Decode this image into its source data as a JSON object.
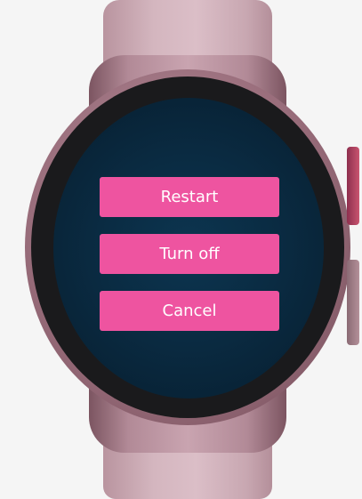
{
  "dialog": {
    "buttons": [
      {
        "label": "Restart"
      },
      {
        "label": "Turn off"
      },
      {
        "label": "Cancel"
      }
    ]
  },
  "colors": {
    "button_bg": "#ee54a0",
    "button_text": "#ffffff",
    "screen_bg": "#0a2b42",
    "strap": "#d4b6bf",
    "case": "#9a6e7c"
  }
}
